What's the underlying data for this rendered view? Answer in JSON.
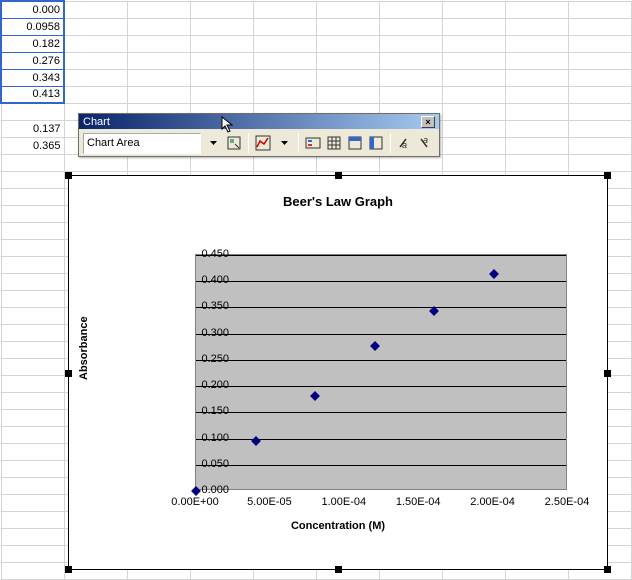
{
  "cells": {
    "colA": [
      "0.000",
      "0.0958",
      "0.182",
      "0.276",
      "0.343",
      "0.413",
      "",
      "0.137",
      "0.365"
    ]
  },
  "selectedRange": {
    "start": 0,
    "end": 5
  },
  "toolbar": {
    "title": "Chart",
    "select_value": "Chart Area",
    "close": "×",
    "buttons": {
      "format": "format-object-icon",
      "chart_type": "chart-type-icon",
      "legend": "legend-icon",
      "data_table": "data-table-icon",
      "by_row": "by-row-icon",
      "by_col": "by-col-icon",
      "angle_ccw": "angle-ccw-icon",
      "angle_cw": "angle-cw-icon"
    }
  },
  "chart_data": {
    "type": "scatter",
    "title": "Beer's Law Graph",
    "xlabel": "Concentration (M)",
    "ylabel": "Absorbance",
    "xlim": [
      0,
      0.00025
    ],
    "ylim": [
      0,
      0.45
    ],
    "xticks": [
      "0.00E+00",
      "5.00E-05",
      "1.00E-04",
      "1.50E-04",
      "2.00E-04",
      "2.50E-04"
    ],
    "yticks": [
      "0.000",
      "0.050",
      "0.100",
      "0.150",
      "0.200",
      "0.250",
      "0.300",
      "0.350",
      "0.400",
      "0.450"
    ],
    "x": [
      0,
      4e-05,
      8e-05,
      0.00012,
      0.00016,
      0.0002
    ],
    "y": [
      0.0,
      0.0958,
      0.182,
      0.276,
      0.343,
      0.413
    ]
  }
}
